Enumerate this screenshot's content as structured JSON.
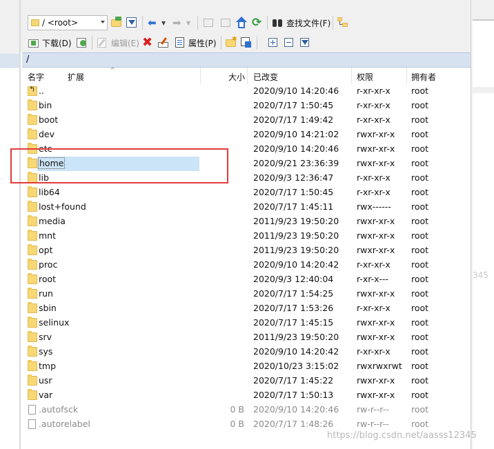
{
  "toolbar": {
    "path_combo": "/ <root>",
    "find_files_label": "查找文件(F)",
    "download_label": "下载(D)",
    "edit_label": "编辑(E)",
    "properties_label": "属性(P)"
  },
  "current_path": "/",
  "columns": {
    "name": "名字",
    "ext": "扩展",
    "size": "大小",
    "modified": "已改变",
    "permissions": "权限",
    "owner": "拥有者"
  },
  "files": [
    {
      "name": "..",
      "size": "",
      "modified": "2020/9/10 14:20:46",
      "permissions": "r-xr-xr-x",
      "owner": "root",
      "kind": "up"
    },
    {
      "name": "bin",
      "size": "",
      "modified": "2020/7/17 1:50:45",
      "permissions": "r-xr-xr-x",
      "owner": "root",
      "kind": "folder"
    },
    {
      "name": "boot",
      "size": "",
      "modified": "2020/7/17 1:49:42",
      "permissions": "r-xr-xr-x",
      "owner": "root",
      "kind": "folder"
    },
    {
      "name": "dev",
      "size": "",
      "modified": "2020/9/10 14:21:02",
      "permissions": "rwxr-xr-x",
      "owner": "root",
      "kind": "folder"
    },
    {
      "name": "etc",
      "size": "",
      "modified": "2020/9/10 14:20:46",
      "permissions": "rwxr-xr-x",
      "owner": "root",
      "kind": "folder"
    },
    {
      "name": "home",
      "size": "",
      "modified": "2020/9/21 23:36:39",
      "permissions": "rwxr-xr-x",
      "owner": "root",
      "kind": "folder",
      "selected": true
    },
    {
      "name": "lib",
      "size": "",
      "modified": "2020/9/3 12:36:47",
      "permissions": "r-xr-xr-x",
      "owner": "root",
      "kind": "folder"
    },
    {
      "name": "lib64",
      "size": "",
      "modified": "2020/7/17 1:50:45",
      "permissions": "r-xr-xr-x",
      "owner": "root",
      "kind": "folder"
    },
    {
      "name": "lost+found",
      "size": "",
      "modified": "2020/7/17 1:45:11",
      "permissions": "rwx------",
      "owner": "root",
      "kind": "folder"
    },
    {
      "name": "media",
      "size": "",
      "modified": "2011/9/23 19:50:20",
      "permissions": "rwxr-xr-x",
      "owner": "root",
      "kind": "folder"
    },
    {
      "name": "mnt",
      "size": "",
      "modified": "2011/9/23 19:50:20",
      "permissions": "rwxr-xr-x",
      "owner": "root",
      "kind": "folder"
    },
    {
      "name": "opt",
      "size": "",
      "modified": "2011/9/23 19:50:20",
      "permissions": "rwxr-xr-x",
      "owner": "root",
      "kind": "folder"
    },
    {
      "name": "proc",
      "size": "",
      "modified": "2020/9/10 14:20:42",
      "permissions": "r-xr-xr-x",
      "owner": "root",
      "kind": "folder"
    },
    {
      "name": "root",
      "size": "",
      "modified": "2020/9/3 12:40:04",
      "permissions": "r-xr-x---",
      "owner": "root",
      "kind": "folder"
    },
    {
      "name": "run",
      "size": "",
      "modified": "2020/7/17 1:54:25",
      "permissions": "rwxr-xr-x",
      "owner": "root",
      "kind": "folder"
    },
    {
      "name": "sbin",
      "size": "",
      "modified": "2020/7/17 1:53:26",
      "permissions": "r-xr-xr-x",
      "owner": "root",
      "kind": "folder"
    },
    {
      "name": "selinux",
      "size": "",
      "modified": "2020/7/17 1:45:15",
      "permissions": "rwxr-xr-x",
      "owner": "root",
      "kind": "folder"
    },
    {
      "name": "srv",
      "size": "",
      "modified": "2011/9/23 19:50:20",
      "permissions": "rwxr-xr-x",
      "owner": "root",
      "kind": "folder"
    },
    {
      "name": "sys",
      "size": "",
      "modified": "2020/9/10 14:20:42",
      "permissions": "r-xr-xr-x",
      "owner": "root",
      "kind": "folder"
    },
    {
      "name": "tmp",
      "size": "",
      "modified": "2020/10/23 3:15:02",
      "permissions": "rwxrwxrwt",
      "owner": "root",
      "kind": "folder"
    },
    {
      "name": "usr",
      "size": "",
      "modified": "2020/7/17 1:45:22",
      "permissions": "rwxr-xr-x",
      "owner": "root",
      "kind": "folder"
    },
    {
      "name": "var",
      "size": "",
      "modified": "2020/7/17 1:50:13",
      "permissions": "rwxr-xr-x",
      "owner": "root",
      "kind": "folder"
    },
    {
      "name": ".autofsck",
      "size": "0 B",
      "modified": "2020/9/10 14:20:46",
      "permissions": "rw-r--r--",
      "owner": "root",
      "kind": "file"
    },
    {
      "name": ".autorelabel",
      "size": "0 B",
      "modified": "2020/7/17 1:48:26",
      "permissions": "rw-r--r--",
      "owner": "root",
      "kind": "file"
    }
  ],
  "side_text": "345",
  "watermark": "https://blog.csdn.net/aasss12345",
  "colors": {
    "selection": "#cce4f7",
    "path_bar": "#d6e2f0",
    "highlight_box": "#e0393a"
  }
}
